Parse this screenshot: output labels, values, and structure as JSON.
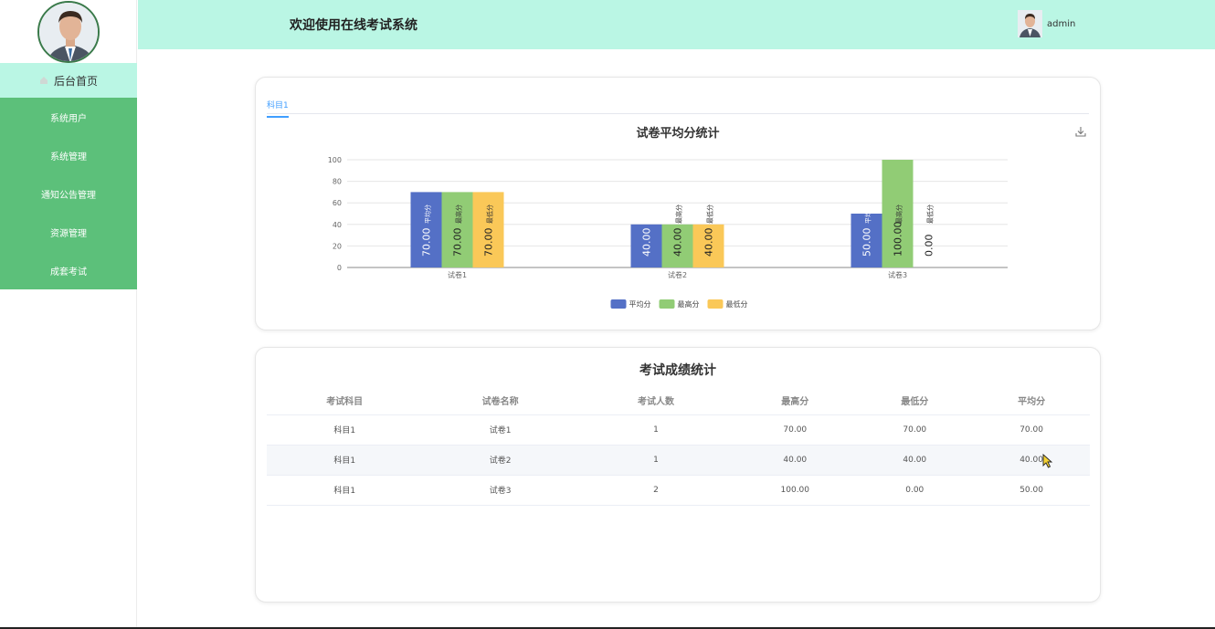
{
  "header": {
    "title": "欢迎使用在线考试系统",
    "user_name": "admin"
  },
  "sidebar": {
    "items": [
      {
        "label": "后台首页",
        "active": true
      },
      {
        "label": "系统用户",
        "active": false
      },
      {
        "label": "系统管理",
        "active": false
      },
      {
        "label": "通知公告管理",
        "active": false
      },
      {
        "label": "资源管理",
        "active": false
      },
      {
        "label": "成套考试",
        "active": false
      }
    ]
  },
  "tabs": [
    {
      "label": "科目1",
      "active": true
    }
  ],
  "chart_data": {
    "type": "bar",
    "title": "试卷平均分统计",
    "categories": [
      "试卷1",
      "试卷2",
      "试卷3"
    ],
    "series": [
      {
        "name": "平均分",
        "values": [
          70,
          40,
          50
        ],
        "labels": [
          "70.00",
          "40.00",
          "50.00"
        ],
        "color": "#5470c6"
      },
      {
        "name": "最高分",
        "values": [
          70,
          40,
          100
        ],
        "labels": [
          "70.00",
          "40.00",
          "100.00"
        ],
        "color": "#91cc75"
      },
      {
        "name": "最低分",
        "values": [
          70,
          40,
          0
        ],
        "labels": [
          "70.00",
          "40.00",
          "0.00"
        ],
        "color": "#fac858"
      }
    ],
    "ylim": [
      0,
      100
    ],
    "yticks": [
      0,
      20,
      40,
      60,
      80,
      100
    ],
    "grid": true,
    "legend": "bottom-center"
  },
  "score_table": {
    "title": "考试成绩统计",
    "columns": [
      "考试科目",
      "试卷名称",
      "考试人数",
      "最高分",
      "最低分",
      "平均分"
    ],
    "rows": [
      [
        "科目1",
        "试卷1",
        "1",
        "70.00",
        "70.00",
        "70.00"
      ],
      [
        "科目1",
        "试卷2",
        "1",
        "40.00",
        "40.00",
        "40.00"
      ],
      [
        "科目1",
        "试卷3",
        "2",
        "100.00",
        "0.00",
        "50.00"
      ]
    ]
  },
  "colors": {
    "header_bg": "#baf6e4",
    "sidebar_active_bg": "#baf6e4",
    "sidebar_bg": "#5cc07a",
    "accent": "#409eff"
  },
  "icons": {
    "home": "home-icon",
    "download": "download-icon"
  }
}
